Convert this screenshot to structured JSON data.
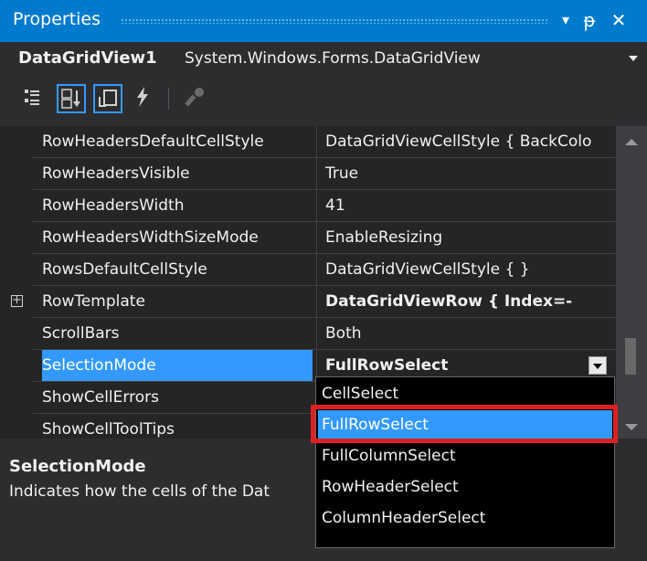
{
  "window": {
    "title": "Properties",
    "controls": {
      "dropdown": "▾",
      "pin": "ᵽ",
      "close": "✕"
    }
  },
  "object_selector": {
    "name": "DataGridView1",
    "type": "System.Windows.Forms.DataGridView"
  },
  "toolbar": {
    "icons": [
      "categorized-icon",
      "alphabetical-icon",
      "properties-icon",
      "events-icon",
      "property-pages-icon"
    ]
  },
  "properties": [
    {
      "name": "RowHeadersDefaultCellStyle",
      "value": "DataGridViewCellStyle { BackColo"
    },
    {
      "name": "RowHeadersVisible",
      "value": "True"
    },
    {
      "name": "RowHeadersWidth",
      "value": "41"
    },
    {
      "name": "RowHeadersWidthSizeMode",
      "value": "EnableResizing"
    },
    {
      "name": "RowsDefaultCellStyle",
      "value": "DataGridViewCellStyle { }"
    },
    {
      "name": "RowTemplate",
      "value": "DataGridViewRow { Index=-"
    },
    {
      "name": "ScrollBars",
      "value": "Both"
    },
    {
      "name": "SelectionMode",
      "value": "FullRowSelect"
    },
    {
      "name": "ShowCellErrors",
      "value": ""
    },
    {
      "name": "ShowCellToolTips",
      "value": ""
    }
  ],
  "dropdown": {
    "options": [
      "CellSelect",
      "FullRowSelect",
      "FullColumnSelect",
      "RowHeaderSelect",
      "ColumnHeaderSelect"
    ],
    "selected": "FullRowSelect"
  },
  "description": {
    "title": "SelectionMode",
    "text": "Indicates how the cells of the Dat"
  },
  "colors": {
    "accent": "#007acc",
    "selection": "#3399ff",
    "highlight": "#e02020"
  }
}
